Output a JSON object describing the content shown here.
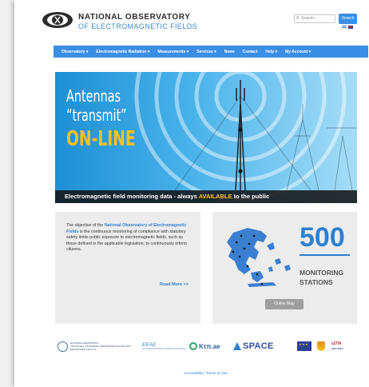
{
  "header": {
    "org_line1": "NATIONAL OBSERVATORY",
    "org_line2": "OF ELECTROMAGNETIC FIELDS",
    "search_placeholder": "Search...",
    "search_button": "Search"
  },
  "nav": {
    "items": [
      {
        "label": "Observatory ▾"
      },
      {
        "label": "Electromagnetic Radiation ▾"
      },
      {
        "label": "Measurements ▾"
      },
      {
        "label": "Services ▾"
      },
      {
        "label": "News"
      },
      {
        "label": "Contact"
      },
      {
        "label": "Help ▾"
      },
      {
        "label": "My Account ▾"
      }
    ]
  },
  "hero": {
    "line1": "Antennas",
    "line2": "“transmit”",
    "line3": "ON-LINE",
    "bar_text_before": "Electromagnetic field monitoring data - always ",
    "bar_text_highlight": "AVAILABLE",
    "bar_text_after": " to the public"
  },
  "intro": {
    "text_before": "The objective of the ",
    "highlight": "National Observatory of Electromagnetic Fields",
    "text_after": " is the continuous monitoring of compliance with statutory safety limits public exposure to electromagnetic fields, such as those defined in the applicable legislation, to continuously inform citizens.",
    "read_more": "Read More >>"
  },
  "stats": {
    "count": "500",
    "label_line1": "MONITORING",
    "label_line2": "STATIONS",
    "button": "Online Map"
  },
  "partners": {
    "ministry_l1": "ΕΛΛΗΝΙΚΗ ΔΗΜΟΚΡΑΤΙΑ",
    "ministry_l2": "ΥΠΟΥΡΓΕΙΟ ΥΠΟΔΟΜΩΝ, ΜΕΤΑΦΟΡΩΝ ΚΑΙ ΔΙΚΤΥΩΝ",
    "ministry_l3": "ΜΕΤΑΦΟΡΕΣ & ΔΙΚΤΥΑ",
    "eeae": "ΕΕΑΕ",
    "eeae_sub": "ΕΛΛΗΝΙΚΗ ΕΠΙΤΡΟΠΗ ΑΤΟΜΙΚΗΣ ΕΝΕΡΓΕΙΑΣ",
    "ktp": "Κτπ.ae",
    "space": "SPACE",
    "espa": "εΣΠΑ",
    "espa_sub": "2007-2013"
  },
  "footer": {
    "links": "Accessibility / Terms of Use"
  },
  "colors": {
    "accent": "#3a8ee6",
    "highlight": "#ffc21a",
    "link": "#2f7fcf"
  }
}
